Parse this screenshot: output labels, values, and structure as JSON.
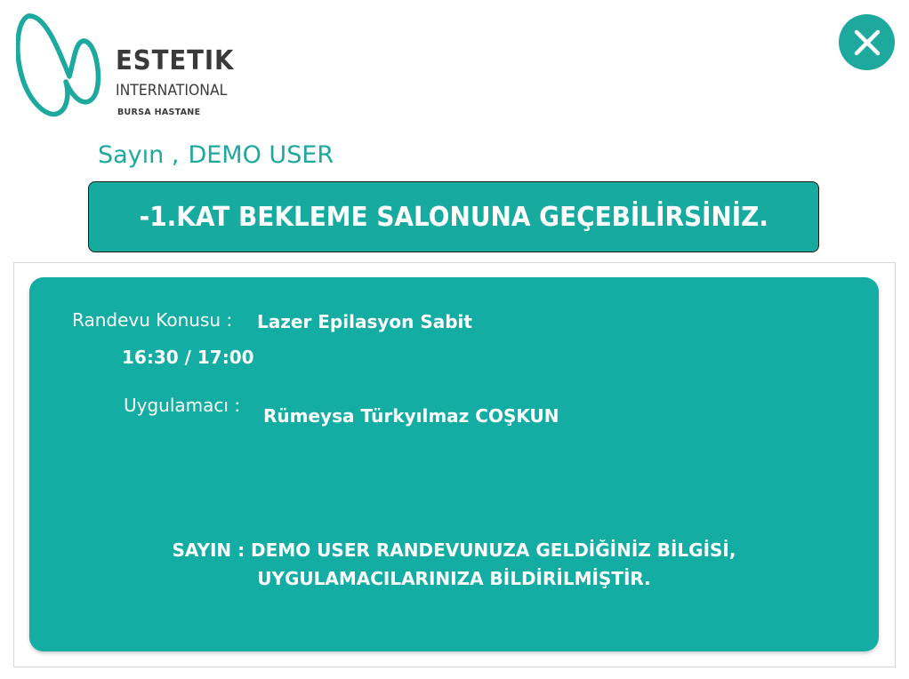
{
  "brand": {
    "name": "ESTETIK",
    "subtitle": "INTERNATIONAL",
    "branch": "BURSA HASTANE",
    "accent_color": "#1ea99e",
    "text_color": "#3a3a3a"
  },
  "header": {
    "close_icon": "close-icon"
  },
  "greeting": {
    "prefix": "Sayın ,",
    "user_name": "DEMO USER"
  },
  "banner": {
    "text": "-1.KAT  BEKLEME SALONUNA GEÇEBİLİRSİNİZ.",
    "color": "#17aba0"
  },
  "appointment": {
    "subject_label": "Randevu Konusu :",
    "subject_value": "Lazer Epilasyon Sabit",
    "time": "16:30 / 17:00",
    "practitioner_label": "Uygulamacı :",
    "practitioner_value": "Rümeysa Türkyılmaz COŞKUN",
    "notice_line1": "SAYIN : DEMO USER RANDEVUNUZA GELDİĞİNİZ BİLGİSİ,",
    "notice_line2": "UYGULAMACILARINIZA BİLDİRİLMİŞTİR.",
    "card_color": "#13ada3"
  }
}
